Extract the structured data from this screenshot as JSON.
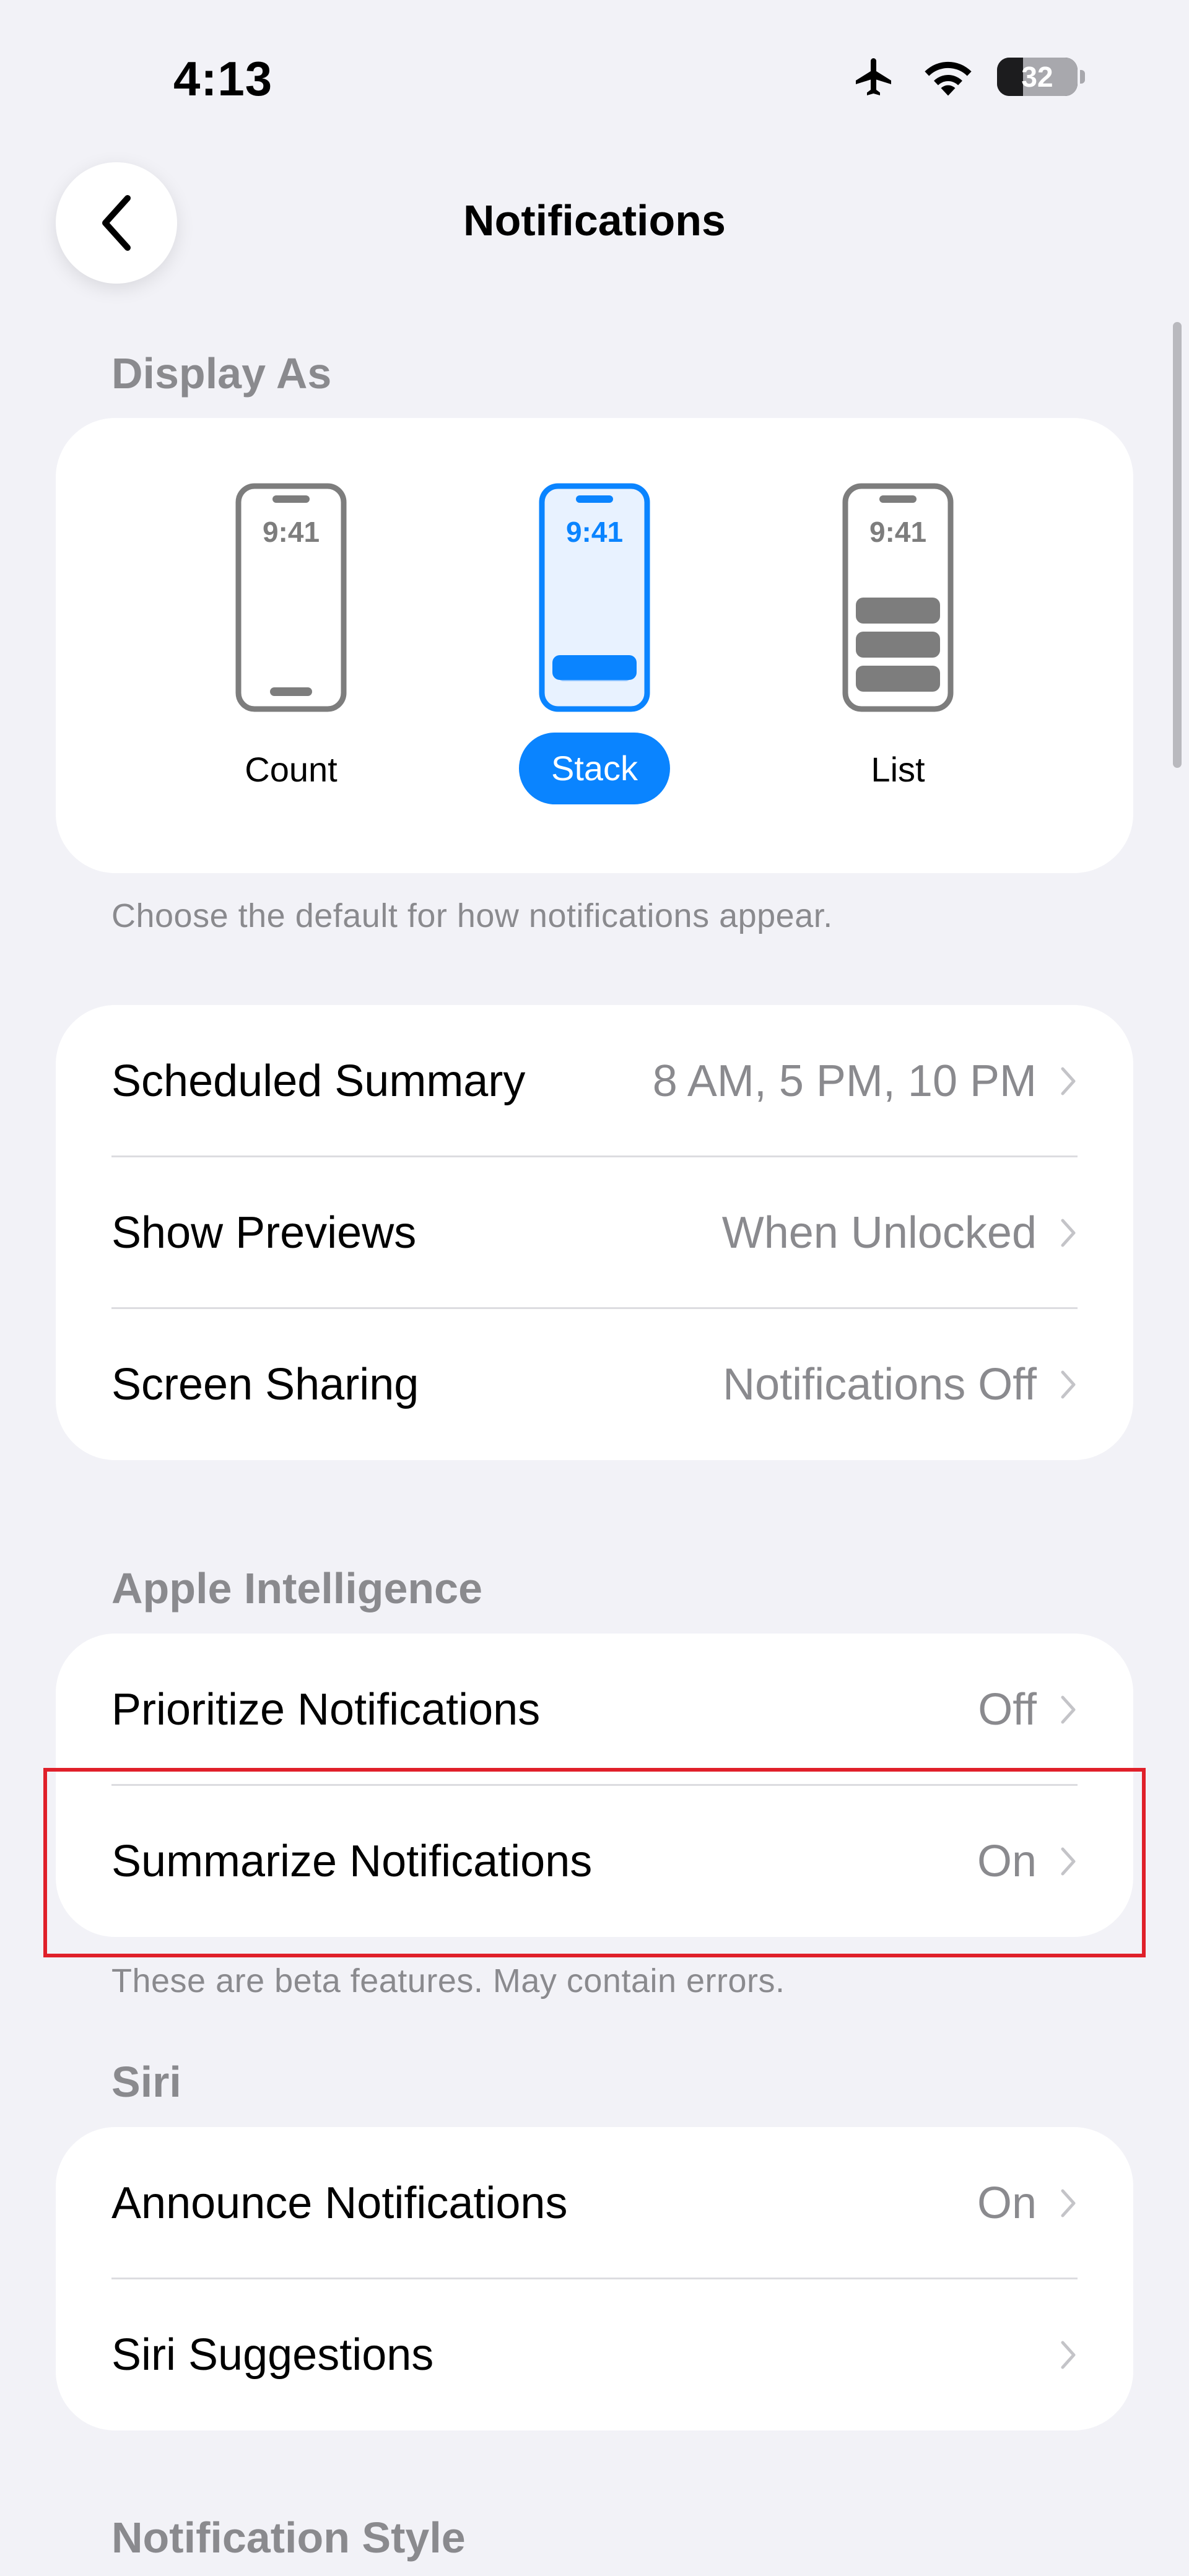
{
  "status_bar": {
    "time": "4:13",
    "battery_level": "32",
    "battery_fraction": 0.32
  },
  "nav": {
    "title": "Notifications"
  },
  "display_as": {
    "header": "Display As",
    "phone_time": "9:41",
    "options": [
      {
        "label": "Count",
        "selected": false
      },
      {
        "label": "Stack",
        "selected": true
      },
      {
        "label": "List",
        "selected": false
      }
    ],
    "footer": "Choose the default for how notifications appear."
  },
  "summary_group": {
    "rows": [
      {
        "label": "Scheduled Summary",
        "value": "8 AM, 5 PM, 10 PM"
      },
      {
        "label": "Show Previews",
        "value": "When Unlocked"
      },
      {
        "label": "Screen Sharing",
        "value": "Notifications Off"
      }
    ]
  },
  "apple_intelligence": {
    "header": "Apple Intelligence",
    "rows": [
      {
        "label": "Prioritize Notifications",
        "value": "Off"
      },
      {
        "label": "Summarize Notifications",
        "value": "On"
      }
    ],
    "footer": "These are beta features. May contain errors."
  },
  "siri": {
    "header": "Siri",
    "rows": [
      {
        "label": "Announce Notifications",
        "value": "On"
      },
      {
        "label": "Siri Suggestions",
        "value": ""
      }
    ]
  },
  "notification_style": {
    "header": "Notification Style"
  },
  "colors": {
    "accent": "#0a84ff",
    "highlight": "#e0202a",
    "background": "#f2f2f7",
    "secondary_text": "#8a8a8e"
  }
}
